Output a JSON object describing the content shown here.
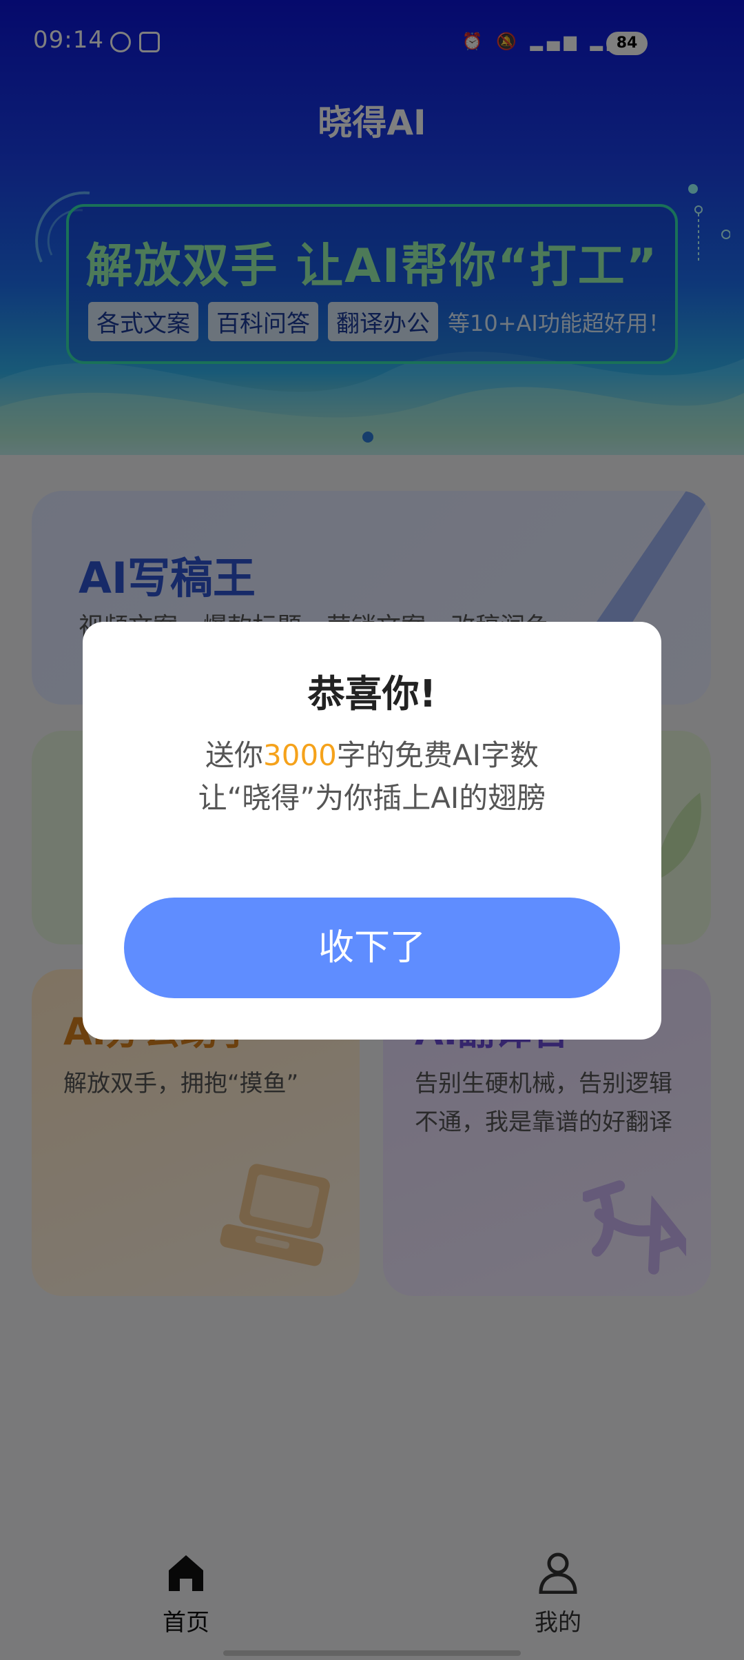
{
  "status_bar": {
    "time": "09:14",
    "battery": "84",
    "indicators": "alarm · mute · signal · 4G · wifi"
  },
  "header": {
    "title": "晓得AI"
  },
  "banner": {
    "headline": "解放双手 让AI帮你“打工”",
    "tags": [
      "各式文案",
      "百科问答",
      "翻译办公"
    ],
    "tail": "等10+AI功能超好用！"
  },
  "cards": {
    "writer": {
      "title": "AI写稿王",
      "desc": "视频文案、爆款标题、营销文案、改稿润色"
    },
    "office": {
      "title": "AI办公助手",
      "desc": "解放双手，拥抱“摸鱼”"
    },
    "translate": {
      "title": "AI翻译官",
      "desc": "告别生硬机械，告别逻辑不通，我是靠谱的好翻译"
    }
  },
  "bottom_nav": {
    "items": [
      {
        "label": "首页",
        "icon": "home-icon",
        "active": true
      },
      {
        "label": "我的",
        "icon": "user-icon",
        "active": false
      }
    ]
  },
  "dialog": {
    "title": "恭喜你!",
    "line1_prefix": "送你",
    "line1_highlight": "3000",
    "line1_suffix": "字的免费AI字数",
    "line2": "让“晓得”为你插上AI的翅膀",
    "button": "收下了"
  },
  "colors": {
    "accent": "#5f8dff",
    "highlight": "#f5a21b",
    "header_blue": "#0b14d8",
    "banner_green": "#35e3b0"
  }
}
